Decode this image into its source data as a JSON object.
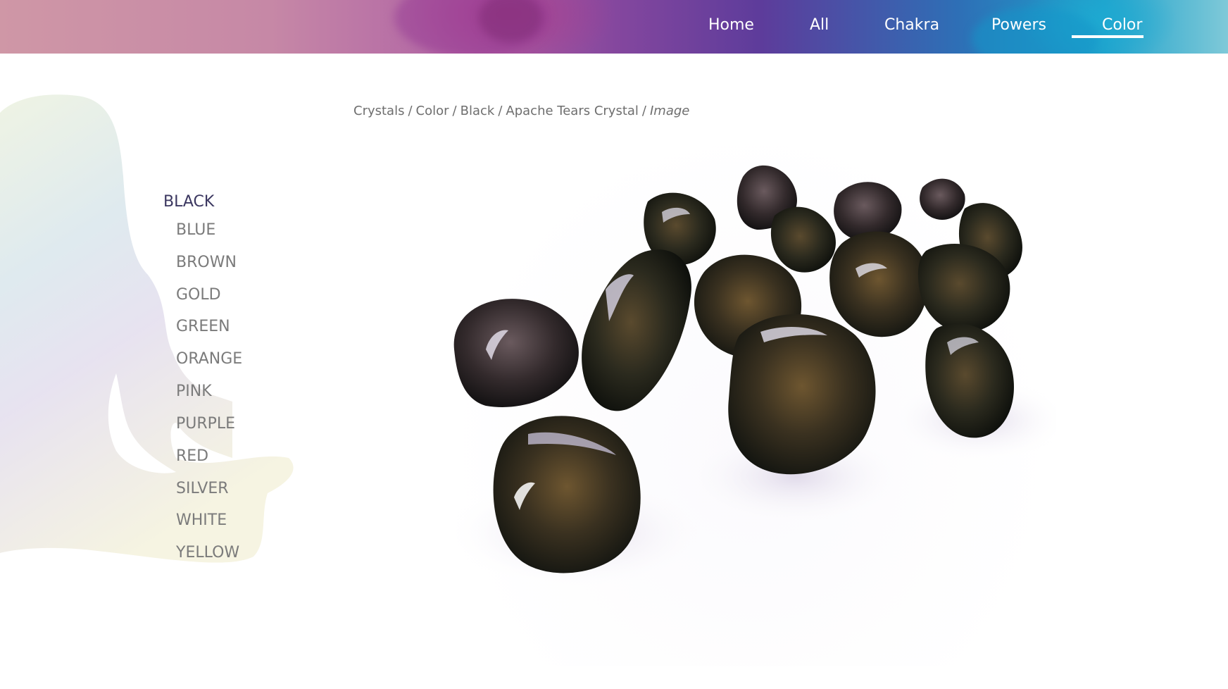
{
  "nav": {
    "items": [
      {
        "label": "Home"
      },
      {
        "label": "All"
      },
      {
        "label": "Chakra"
      },
      {
        "label": "Powers"
      },
      {
        "label": "Color"
      }
    ],
    "active": "Color"
  },
  "breadcrumb": {
    "items": [
      "Crystals",
      "Color",
      "Black",
      "Apache Tears Crystal"
    ],
    "separator": "/",
    "current": "Image"
  },
  "colors": {
    "heading": "BLACK",
    "items": [
      "BLUE",
      "BROWN",
      "GOLD",
      "GREEN",
      "ORANGE",
      "PINK",
      "PURPLE",
      "RED",
      "SILVER",
      "WHITE",
      "YELLOW"
    ]
  },
  "theme": {
    "heading_color": "#3b3760",
    "list_color": "#7b7b7b",
    "breadcrumb_color": "#6e6e6e"
  }
}
